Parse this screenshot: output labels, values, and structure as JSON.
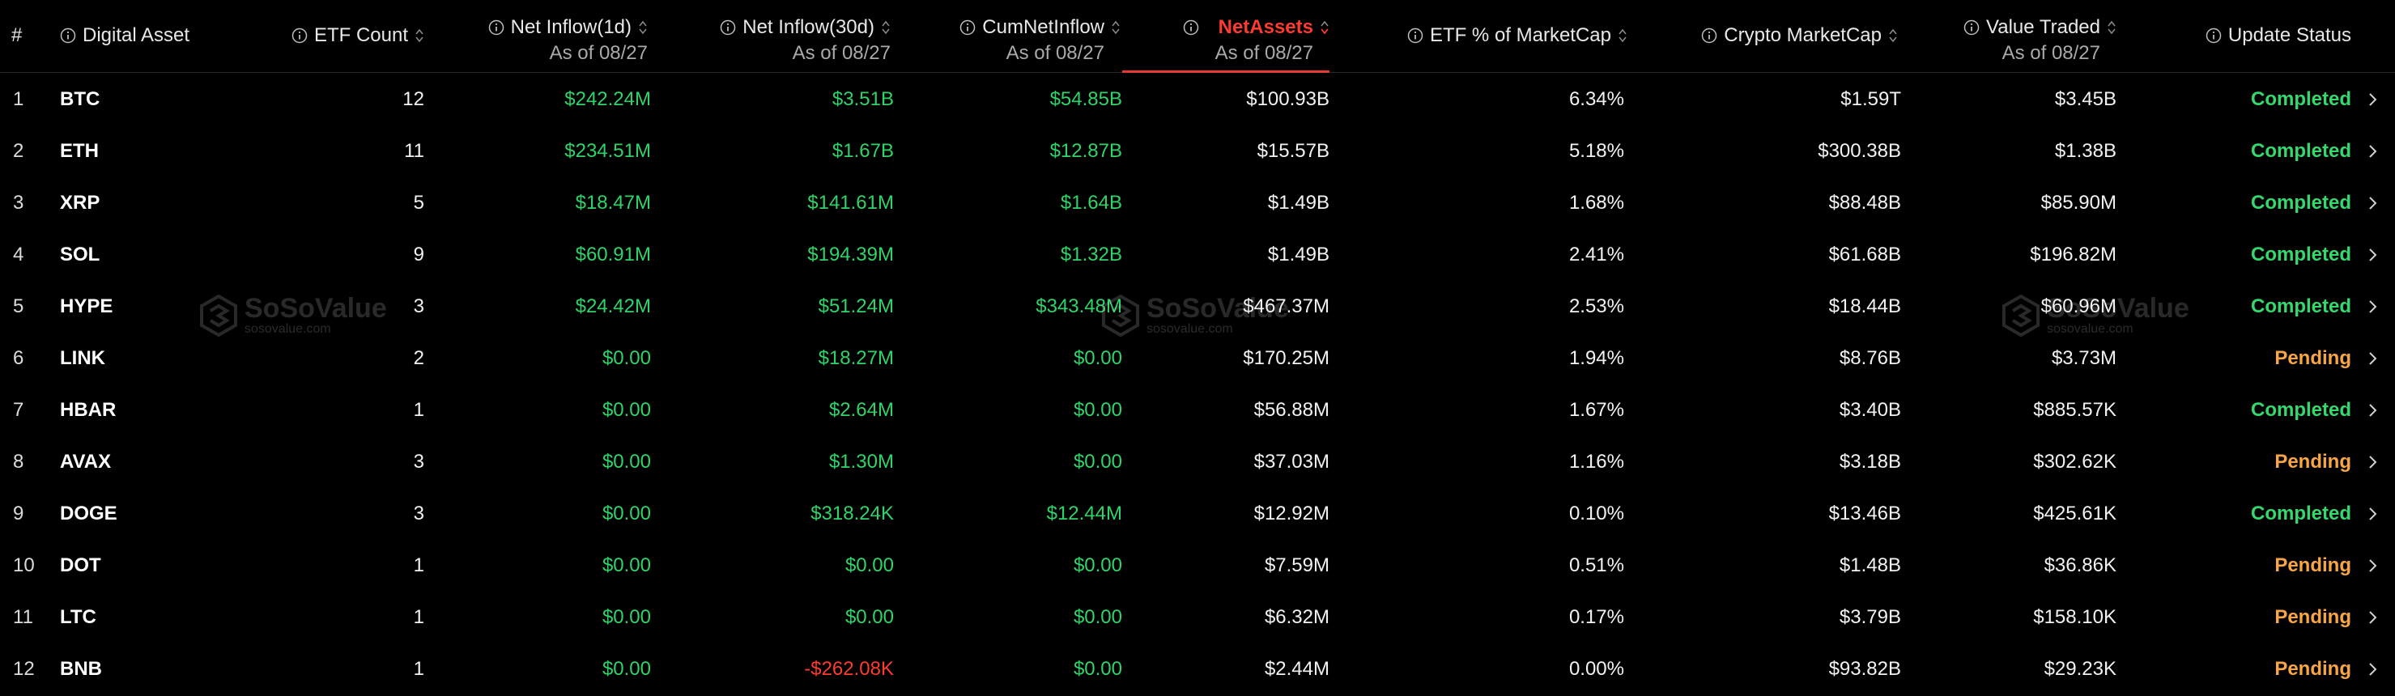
{
  "table": {
    "headers": {
      "index": "#",
      "asset": "Digital Asset",
      "etf_count": "ETF Count",
      "net_inflow_1d": "Net Inflow(1d)",
      "net_inflow_1d_sub": "As of 08/27",
      "net_inflow_30d": "Net Inflow(30d)",
      "net_inflow_30d_sub": "As of 08/27",
      "cum_net_inflow": "CumNetInflow",
      "cum_net_inflow_sub": "As of 08/27",
      "net_assets": "NetAssets",
      "net_assets_sub": "As of 08/27",
      "etf_pct_marketcap": "ETF % of MarketCap",
      "crypto_marketcap": "Crypto MarketCap",
      "value_traded": "Value Traded",
      "value_traded_sub": "As of 08/27",
      "update_status": "Update Status"
    },
    "active_sort_column": "NetAssets",
    "rows": [
      {
        "index": "1",
        "asset": "BTC",
        "etf_count": "12",
        "net_inflow_1d": "$242.24M",
        "net_inflow_30d": "$3.51B",
        "cum_net_inflow": "$54.85B",
        "net_assets": "$100.93B",
        "etf_pct": "6.34%",
        "marketcap": "$1.59T",
        "value_traded": "$3.45B",
        "status": "Completed"
      },
      {
        "index": "2",
        "asset": "ETH",
        "etf_count": "11",
        "net_inflow_1d": "$234.51M",
        "net_inflow_30d": "$1.67B",
        "cum_net_inflow": "$12.87B",
        "net_assets": "$15.57B",
        "etf_pct": "5.18%",
        "marketcap": "$300.38B",
        "value_traded": "$1.38B",
        "status": "Completed"
      },
      {
        "index": "3",
        "asset": "XRP",
        "etf_count": "5",
        "net_inflow_1d": "$18.47M",
        "net_inflow_30d": "$141.61M",
        "cum_net_inflow": "$1.64B",
        "net_assets": "$1.49B",
        "etf_pct": "1.68%",
        "marketcap": "$88.48B",
        "value_traded": "$85.90M",
        "status": "Completed"
      },
      {
        "index": "4",
        "asset": "SOL",
        "etf_count": "9",
        "net_inflow_1d": "$60.91M",
        "net_inflow_30d": "$194.39M",
        "cum_net_inflow": "$1.32B",
        "net_assets": "$1.49B",
        "etf_pct": "2.41%",
        "marketcap": "$61.68B",
        "value_traded": "$196.82M",
        "status": "Completed"
      },
      {
        "index": "5",
        "asset": "HYPE",
        "etf_count": "3",
        "net_inflow_1d": "$24.42M",
        "net_inflow_30d": "$51.24M",
        "cum_net_inflow": "$343.48M",
        "net_assets": "$467.37M",
        "etf_pct": "2.53%",
        "marketcap": "$18.44B",
        "value_traded": "$60.96M",
        "status": "Completed"
      },
      {
        "index": "6",
        "asset": "LINK",
        "etf_count": "2",
        "net_inflow_1d": "$0.00",
        "net_inflow_30d": "$18.27M",
        "cum_net_inflow": "$0.00",
        "net_assets": "$170.25M",
        "etf_pct": "1.94%",
        "marketcap": "$8.76B",
        "value_traded": "$3.73M",
        "status": "Pending"
      },
      {
        "index": "7",
        "asset": "HBAR",
        "etf_count": "1",
        "net_inflow_1d": "$0.00",
        "net_inflow_30d": "$2.64M",
        "cum_net_inflow": "$0.00",
        "net_assets": "$56.88M",
        "etf_pct": "1.67%",
        "marketcap": "$3.40B",
        "value_traded": "$885.57K",
        "status": "Completed"
      },
      {
        "index": "8",
        "asset": "AVAX",
        "etf_count": "3",
        "net_inflow_1d": "$0.00",
        "net_inflow_30d": "$1.30M",
        "cum_net_inflow": "$0.00",
        "net_assets": "$37.03M",
        "etf_pct": "1.16%",
        "marketcap": "$3.18B",
        "value_traded": "$302.62K",
        "status": "Pending"
      },
      {
        "index": "9",
        "asset": "DOGE",
        "etf_count": "3",
        "net_inflow_1d": "$0.00",
        "net_inflow_30d": "$318.24K",
        "cum_net_inflow": "$12.44M",
        "net_assets": "$12.92M",
        "etf_pct": "0.10%",
        "marketcap": "$13.46B",
        "value_traded": "$425.61K",
        "status": "Completed"
      },
      {
        "index": "10",
        "asset": "DOT",
        "etf_count": "1",
        "net_inflow_1d": "$0.00",
        "net_inflow_30d": "$0.00",
        "cum_net_inflow": "$0.00",
        "net_assets": "$7.59M",
        "etf_pct": "0.51%",
        "marketcap": "$1.48B",
        "value_traded": "$36.86K",
        "status": "Pending"
      },
      {
        "index": "11",
        "asset": "LTC",
        "etf_count": "1",
        "net_inflow_1d": "$0.00",
        "net_inflow_30d": "$0.00",
        "cum_net_inflow": "$0.00",
        "net_assets": "$6.32M",
        "etf_pct": "0.17%",
        "marketcap": "$3.79B",
        "value_traded": "$158.10K",
        "status": "Pending"
      },
      {
        "index": "12",
        "asset": "BNB",
        "etf_count": "1",
        "net_inflow_1d": "$0.00",
        "net_inflow_30d": "-$262.08K",
        "cum_net_inflow": "$0.00",
        "net_assets": "$2.44M",
        "etf_pct": "0.00%",
        "marketcap": "$93.82B",
        "value_traded": "$29.23K",
        "status": "Pending"
      }
    ]
  },
  "watermark": {
    "brand": "SoSoValue",
    "domain": "sosovalue.com"
  },
  "colors": {
    "positive": "#2fd36a",
    "negative": "#ff3b30",
    "completed": "#35d86e",
    "pending": "#f7a545",
    "active_sort": "#ff3b30",
    "background": "#000000"
  },
  "icons": {
    "info": "info-circle-icon",
    "sort": "sort-updown-icon",
    "row_action": "chevron-right-icon"
  }
}
